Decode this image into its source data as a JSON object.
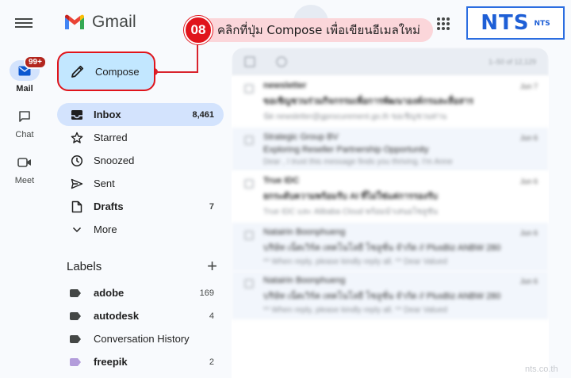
{
  "rail": {
    "mail_label": "Mail",
    "mail_badge": "99+",
    "chat_label": "Chat",
    "meet_label": "Meet"
  },
  "header": {
    "app_name": "Gmail",
    "brand_logo": "NTS",
    "brand_logo_small": "NTS"
  },
  "callout": {
    "step": "08",
    "text": "คลิกที่ปุ่ม Compose เพื่อเขียนอีเมลใหม่"
  },
  "compose": {
    "label": "Compose"
  },
  "nav": {
    "items": [
      {
        "label": "Inbox",
        "count": "8,461",
        "icon": "inbox-icon"
      },
      {
        "label": "Starred",
        "count": "",
        "icon": "star-icon"
      },
      {
        "label": "Snoozed",
        "count": "",
        "icon": "clock-icon"
      },
      {
        "label": "Sent",
        "count": "",
        "icon": "send-icon"
      },
      {
        "label": "Drafts",
        "count": "7",
        "icon": "draft-icon"
      },
      {
        "label": "More",
        "count": "",
        "icon": "chevron-down-icon"
      }
    ]
  },
  "labels": {
    "title": "Labels",
    "items": [
      {
        "name": "adobe",
        "count": "169",
        "color": "#444746"
      },
      {
        "name": "autodesk",
        "count": "4",
        "color": "#444746"
      },
      {
        "name": "Conversation History",
        "count": "",
        "color": "#444746"
      },
      {
        "name": "freepik",
        "count": "2",
        "color": "#b39ddb"
      }
    ]
  },
  "list": {
    "range": "1–50 of 12,129",
    "rows": [
      {
        "sender": "newsletter",
        "subject": "ขอเชิญชวนร่วมกิจกรรมเพื่อการพัฒนาองค์กรและสื่อสาร",
        "snippet": "นัด newsletter@gprocurement.go.th ขอเชิญชวนท่าน",
        "date": "Jun 7"
      },
      {
        "sender": "Strategic Group BV",
        "subject": "Exploring Reseller Partnership Opportunity",
        "snippet": "Dear , I trust this message finds you thriving. I'm Anne",
        "date": "Jun 6"
      },
      {
        "sender": "True IDC",
        "subject": "ยกระดับความพร้อมรับ AI ที่ไม่ใช่แค่การรองรับ",
        "snippet": "True IDC และ Alibaba Cloud พร้อมนำเสนอโซลูชัน",
        "date": "Jun 6"
      },
      {
        "sender": "Natairin Boonphueng",
        "subject": "บริษัท เน็ตเวิร์ค เทคโนโลยี โซลูชั่น จำกัด // PlusBiz ANBW 280",
        "snippet": "** When reply, please kindly reply all. ** Dear Valued",
        "date": "Jun 6"
      },
      {
        "sender": "Natairin Boonphueng",
        "subject": "บริษัท เน็ตเวิร์ค เทคโนโลยี โซลูชั่น จำกัด // PlusBiz ANBW 280",
        "snippet": "** When reply, please kindly reply all. ** Dear Valued",
        "date": "Jun 6"
      }
    ]
  },
  "watermark": "nts.co.th",
  "colors": {
    "accent_red": "#e0141b",
    "compose_bg": "#c2e7ff",
    "active_nav_bg": "#d3e3fd",
    "brand_blue": "#1e5fd6"
  }
}
